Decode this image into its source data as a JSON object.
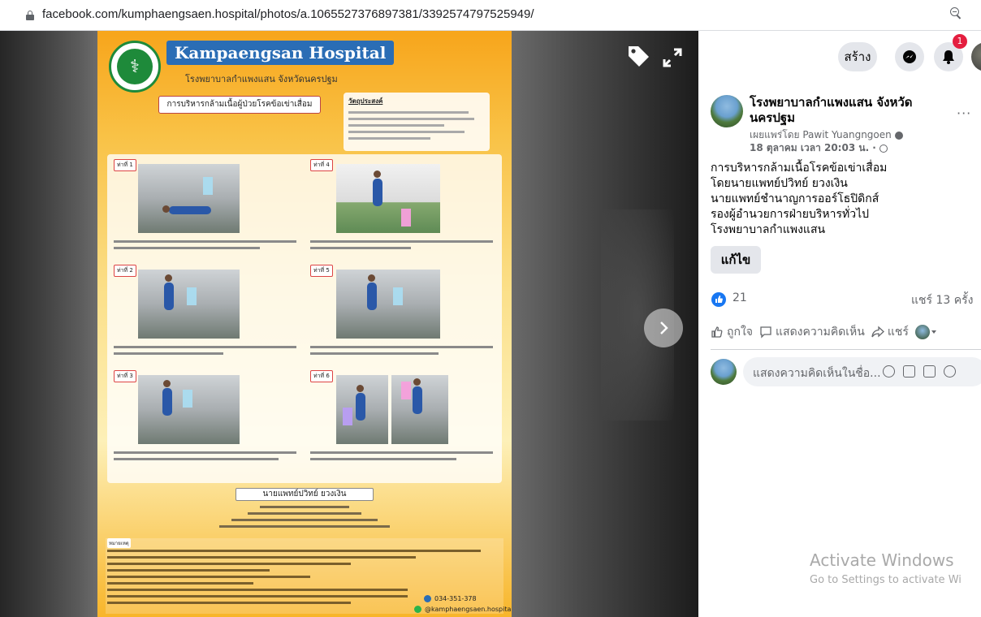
{
  "browser": {
    "url": "facebook.com/kumphaengsaen.hospital/photos/a.1065527376897381/3392574797525949/"
  },
  "photo": {
    "poster_title": "Kampaengsan Hospital",
    "poster_subtitle": "โรงพยาบาลกำแพงแสน จังหวัดนครปฐม",
    "topic": "การบริหารกล้ามเนื้อผู้ป่วยโรคข้อเข่าเสื่อม",
    "objective_heading": "วัตถุประสงค์",
    "steps": [
      {
        "label": "ท่าที่ 1"
      },
      {
        "label": "ท่าที่ 4"
      },
      {
        "label": "ท่าที่ 2"
      },
      {
        "label": "ท่าที่ 5"
      },
      {
        "label": "ท่าที่ 3"
      },
      {
        "label": "ท่าที่ 6"
      }
    ],
    "doctor_name": "นายแพทย์ปวิทย์ ยวงเงิน",
    "note_label": "หมายเหตุ",
    "phone": "034-351-378",
    "line_id": "@kamphaengsaen.hospital"
  },
  "topbar": {
    "create_label": "สร้าง",
    "notification_count": "1"
  },
  "post": {
    "page_name": "โรงพยาบาลกำแพงแสน จังหวัดนครปฐม",
    "published_by": "เผยแพร่โดย Pawit Yuangngoen",
    "date": "18 ตุลาคม เวลา 20:03 น. ·",
    "caption_lines": [
      "การบริหารกล้ามเนื้อโรคข้อเข่าเสื่อม",
      "โดยนายแพทย์ปวิทย์ ยวงเงิน",
      "นายแพทย์ชำนาญการออร์โธปิดิกส์",
      "รองผู้อำนวยการฝ่ายบริหารทั่วไป",
      "โรงพยาบาลกำแพงแสน"
    ],
    "edit_label": "แก้ไข",
    "like_count": "21",
    "share_count": "แชร์ 13 ครั้ง",
    "like_label": "ถูกใจ",
    "comment_label": "แสดงความคิดเห็น",
    "share_label": "แชร์",
    "comment_placeholder": "แสดงความคิดเห็นในชื่อ..."
  },
  "watermark": {
    "line1": "Activate Windows",
    "line2": "Go to Settings to activate Wi"
  },
  "colors": {
    "facebook_blue": "#1877f2",
    "badge_red": "#e41e3f",
    "poster_orange": "#f7a51b"
  }
}
